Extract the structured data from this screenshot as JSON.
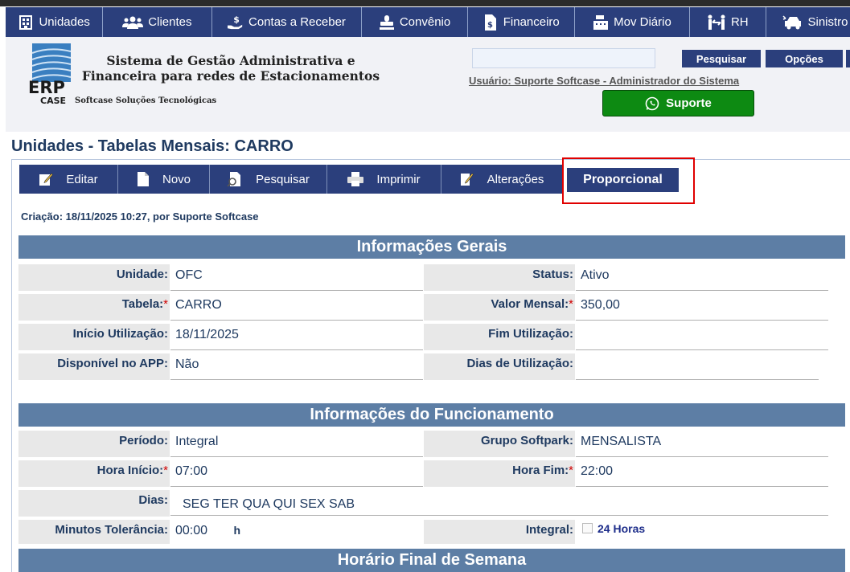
{
  "nav": {
    "items": [
      {
        "label": "Unidades",
        "icon": "building-icon"
      },
      {
        "label": "Clientes",
        "icon": "users-icon"
      },
      {
        "label": "Contas a Receber",
        "icon": "hand-money-icon"
      },
      {
        "label": "Convênio",
        "icon": "stamp-icon"
      },
      {
        "label": "Financeiro",
        "icon": "invoice-icon"
      },
      {
        "label": "Mov Diário",
        "icon": "cash-register-icon"
      },
      {
        "label": "RH",
        "icon": "people-arrows-icon"
      },
      {
        "label": "Sinistro",
        "icon": "car-crash-icon"
      }
    ]
  },
  "header": {
    "logo_text": "ERP",
    "logo_sub": "CASE",
    "system_title_line1": "Sistema de Gestão Administrativa e",
    "system_title_line2": "Financeira para redes de Estacionamentos",
    "company": "Softcase Soluções Tecnológicas",
    "search_value": "",
    "search_button": "Pesquisar",
    "options_button": "Opções",
    "user_link": "Usuário: Suporte Softcase - Administrador do Sistema",
    "support_button": "Suporte"
  },
  "page": {
    "title": "Unidades - Tabelas Mensais: CARRO",
    "criacao": "Criação: 18/11/2025 10:27, por Suporte Softcase"
  },
  "toolbar": {
    "editar": "Editar",
    "novo": "Novo",
    "pesquisar": "Pesquisar",
    "imprimir": "Imprimir",
    "alteracoes": "Alterações",
    "proporcional": "Proporcional"
  },
  "colors": {
    "nav_bg": "#2b3f7c",
    "section_bg": "#5d7ea5",
    "support_green": "#0d8a12",
    "highlight_red": "#e00000"
  },
  "sections": {
    "gerais": {
      "title": "Informações Gerais",
      "unidade_label": "Unidade:",
      "unidade_value": "OFC",
      "status_label": "Status:",
      "status_value": "Ativo",
      "tabela_label": "Tabela:",
      "tabela_value": "CARRO",
      "valor_label": "Valor Mensal:",
      "valor_value": "350,00",
      "inicio_label": "Início Utilização:",
      "inicio_value": "18/11/2025",
      "fim_label": "Fim Utilização:",
      "fim_value": "",
      "app_label": "Disponível no APP:",
      "app_value": "Não",
      "dias_util_label": "Dias de Utilização:",
      "dias_util_value": ""
    },
    "funcionamento": {
      "title": "Informações do Funcionamento",
      "periodo_label": "Período:",
      "periodo_value": "Integral",
      "grupo_label": "Grupo Softpark:",
      "grupo_value": "MENSALISTA",
      "hora_inicio_label": "Hora Início:",
      "hora_inicio_value": "07:00",
      "hora_fim_label": "Hora Fim:",
      "hora_fim_value": "22:00",
      "dias_label": "Dias:",
      "dias_value": "SEG TER QUA QUI SEX SAB",
      "tolerancia_label": "Minutos Tolerância:",
      "tolerancia_value": "00:00",
      "tolerancia_unit": "h",
      "integral_label": "Integral:",
      "integral_checked": false,
      "integral_text": "24 Horas"
    },
    "final_semana": {
      "title": "Horário Final de Semana"
    }
  }
}
